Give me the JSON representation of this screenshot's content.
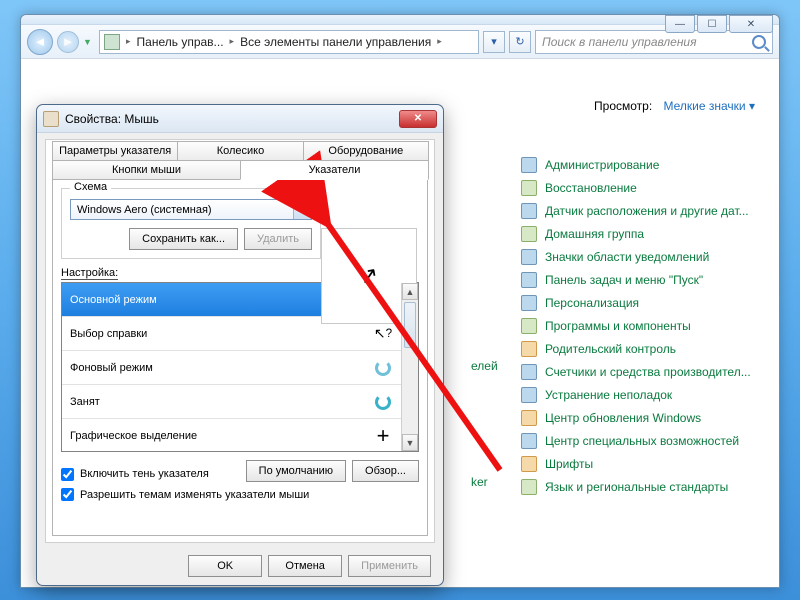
{
  "cp_window": {
    "breadcrumb": {
      "root_icon": "control-panel-icon",
      "part1": "Панель управ...",
      "part2": "Все элементы панели управления"
    },
    "search_placeholder": "Поиск в панели управления",
    "view": {
      "label": "Просмотр:",
      "value": "Мелкие значки"
    },
    "truncated_labels": {
      "a": "елей",
      "b": "ker"
    },
    "items": [
      "Администрирование",
      "Восстановление",
      "Датчик расположения и другие дат...",
      "Домашняя группа",
      "Значки области уведомлений",
      "Панель задач и меню \"Пуск\"",
      "Персонализация",
      "Программы и компоненты",
      "Родительский контроль",
      "Счетчики и средства производител...",
      "Устранение неполадок",
      "Центр обновления Windows",
      "Центр специальных возможностей",
      "Шрифты",
      "Язык и региональные стандарты"
    ]
  },
  "dialog": {
    "title": "Свойства: Мышь",
    "tabs": {
      "row1": [
        "Параметры указателя",
        "Колесико",
        "Оборудование"
      ],
      "row2": [
        "Кнопки мыши",
        "Указатели"
      ],
      "active": "Указатели"
    },
    "scheme": {
      "legend": "Схема",
      "value": "Windows Aero (системная)",
      "save_as": "Сохранить как...",
      "delete": "Удалить"
    },
    "customize_label": "Настройка:",
    "list": [
      {
        "name": "Основной режим",
        "cursor": "arrow",
        "selected": true
      },
      {
        "name": "Выбор справки",
        "cursor": "help",
        "selected": false
      },
      {
        "name": "Фоновый режим",
        "cursor": "spinner",
        "selected": false
      },
      {
        "name": "Занят",
        "cursor": "busy",
        "selected": false
      },
      {
        "name": "Графическое выделение",
        "cursor": "cross",
        "selected": false
      }
    ],
    "checks": {
      "shadow": "Включить тень указателя",
      "themes": "Разрешить темам изменять указатели мыши"
    },
    "buttons": {
      "defaults": "По умолчанию",
      "browse": "Обзор...",
      "ok": "OK",
      "cancel": "Отмена",
      "apply": "Применить"
    }
  }
}
